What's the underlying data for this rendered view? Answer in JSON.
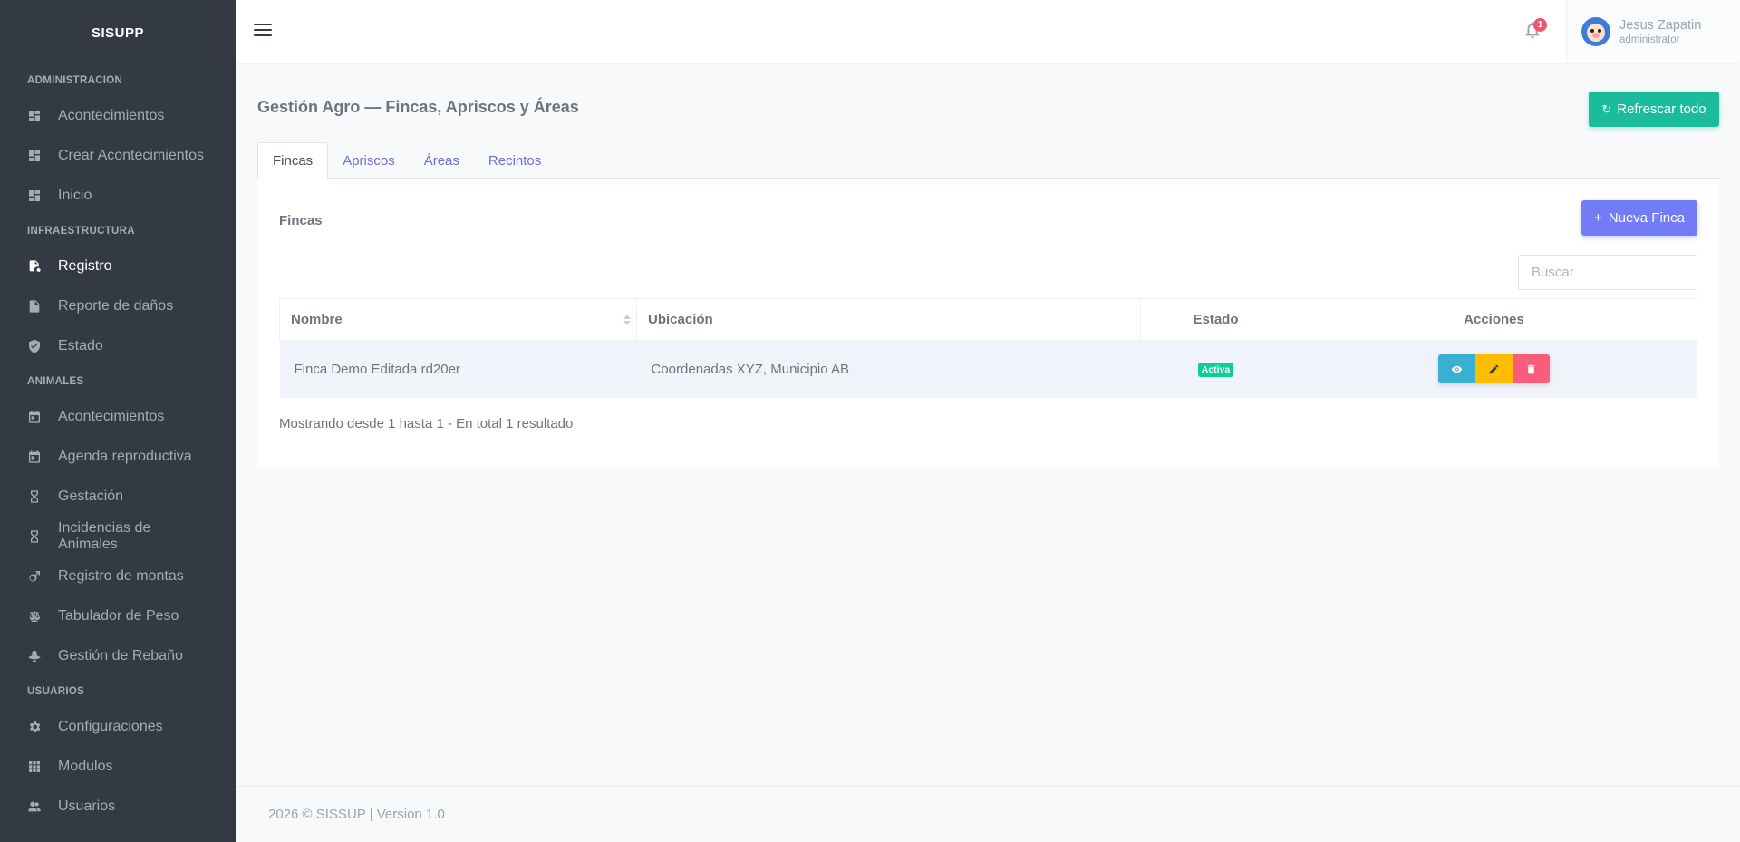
{
  "sidebar": {
    "brand": "SISUPP",
    "sections": [
      {
        "title": "ADMINISTRACION",
        "items": [
          {
            "label": "Acontecimientos",
            "icon": "dashboard-icon"
          },
          {
            "label": "Crear Acontecimientos",
            "icon": "dashboard-icon"
          },
          {
            "label": "Inicio",
            "icon": "dashboard-icon"
          }
        ]
      },
      {
        "title": "INFRAESTRUCTURA",
        "items": [
          {
            "label": "Registro",
            "icon": "file-cog-icon",
            "active": true
          },
          {
            "label": "Reporte de daños",
            "icon": "file-icon"
          },
          {
            "label": "Estado",
            "icon": "shield-check-icon"
          }
        ]
      },
      {
        "title": "ANIMALES",
        "items": [
          {
            "label": "Acontecimientos",
            "icon": "calendar-icon"
          },
          {
            "label": "Agenda reproductiva",
            "icon": "calendar-icon"
          },
          {
            "label": "Gestación",
            "icon": "hourglass-icon"
          },
          {
            "label": "Incidencias de Animales",
            "icon": "hourglass-icon"
          },
          {
            "label": "Registro de montas",
            "icon": "gender-icon"
          },
          {
            "label": "Tabulador de Peso",
            "icon": "scale-icon"
          },
          {
            "label": "Gestión de Rebaño",
            "icon": "cowboy-hat-icon"
          }
        ]
      },
      {
        "title": "USUARIOS",
        "items": [
          {
            "label": "Configuraciones",
            "icon": "gear-icon"
          },
          {
            "label": "Modulos",
            "icon": "grid-icon"
          },
          {
            "label": "Usuarios",
            "icon": "users-icon"
          }
        ]
      }
    ]
  },
  "topbar": {
    "notification_count": "1",
    "user_name": "Jesus Zapatin",
    "user_role": "administrator"
  },
  "page": {
    "title": "Gestión Agro — Fincas, Apriscos y Áreas",
    "refresh_label": "Refrescar todo"
  },
  "tabs": [
    {
      "label": "Fincas",
      "active": true
    },
    {
      "label": "Apriscos"
    },
    {
      "label": "Áreas"
    },
    {
      "label": "Recintos"
    }
  ],
  "card": {
    "title": "Fincas",
    "new_label": "Nueva Finca",
    "search_placeholder": "Buscar",
    "columns": {
      "nombre": "Nombre",
      "ubicacion": "Ubicación",
      "estado": "Estado",
      "acciones": "Acciones"
    },
    "rows": [
      {
        "nombre": "Finca Demo Editada rd20er",
        "ubicacion": "Coordenadas XYZ, Municipio AB",
        "estado": "Activa"
      }
    ],
    "showing_text": "Mostrando desde 1 hasta 1 - En total 1 resultado"
  },
  "footer": {
    "text": "2026 © SISSUP | Version 1.0"
  },
  "colors": {
    "sidebar_bg": "#343a44",
    "primary": "#727cf5",
    "success": "#1abc9c",
    "info": "#39afd1",
    "warning": "#ffbc00",
    "danger": "#fa5c7c"
  }
}
